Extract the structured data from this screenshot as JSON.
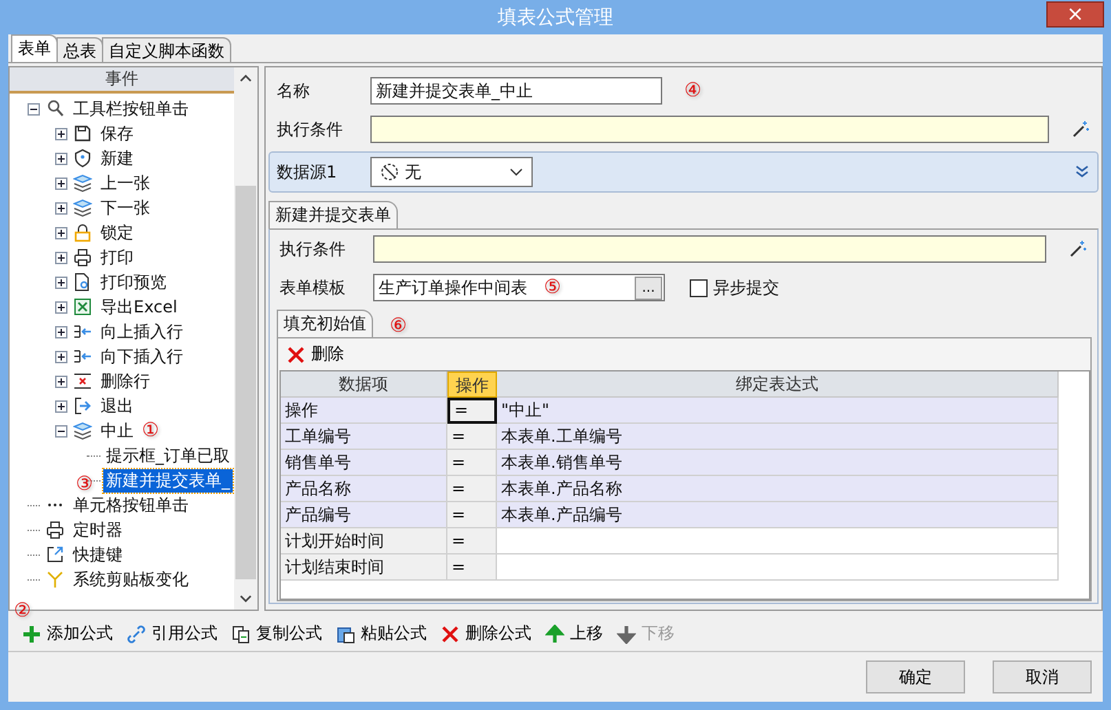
{
  "window": {
    "title": "填表公式管理",
    "close": "×"
  },
  "tabs": [
    {
      "label": "表单",
      "selected": true
    },
    {
      "label": "总表",
      "selected": false
    },
    {
      "label": "自定义脚本函数",
      "selected": false
    }
  ],
  "tree": {
    "header": "事件",
    "items": [
      {
        "label": "工具栏按钮单击",
        "expanded": true,
        "selected": false,
        "children": [
          {
            "label": "保存",
            "expanded": false,
            "selected": false
          },
          {
            "label": "新建",
            "expanded": false,
            "selected": false
          },
          {
            "label": "上一张",
            "expanded": false,
            "selected": false
          },
          {
            "label": "下一张",
            "expanded": false,
            "selected": false
          },
          {
            "label": "锁定",
            "expanded": false,
            "selected": false
          },
          {
            "label": "打印",
            "expanded": false,
            "selected": false
          },
          {
            "label": "打印预览",
            "expanded": false,
            "selected": false
          },
          {
            "label": "导出Excel",
            "expanded": false,
            "selected": false
          },
          {
            "label": "向上插入行",
            "expanded": false,
            "selected": false
          },
          {
            "label": "向下插入行",
            "expanded": false,
            "selected": false
          },
          {
            "label": "删除行",
            "expanded": false,
            "selected": false
          },
          {
            "label": "退出",
            "expanded": false,
            "selected": false
          },
          {
            "label": "中止",
            "expanded": true,
            "selected": false,
            "marker": "①",
            "children": [
              {
                "label": "提示框_订单已取",
                "selected": false
              },
              {
                "label": "新建并提交表单_",
                "selected": true,
                "marker": "③"
              }
            ]
          }
        ]
      },
      {
        "label": "单元格按钮单击",
        "selected": false
      },
      {
        "label": "定时器",
        "selected": false
      },
      {
        "label": "快捷键",
        "selected": false
      },
      {
        "label": "系统剪贴板变化",
        "selected": false
      }
    ]
  },
  "form": {
    "name_label": "名称",
    "name_value": "新建并提交表单_中止",
    "name_marker": "④",
    "condition_label": "执行条件",
    "datasource_label": "数据源1",
    "datasource_value": "无"
  },
  "action_tab": "新建并提交表单",
  "action": {
    "condition_label": "执行条件",
    "template_label": "表单模板",
    "template_value": "生产订单操作中间表",
    "template_marker": "⑤",
    "browse": "...",
    "async_label": "异步提交",
    "async_checked": false
  },
  "fill_tab": {
    "label": "填充初始值",
    "marker": "⑥",
    "delete": "删除"
  },
  "table": {
    "columns": [
      "数据项",
      "操作",
      "绑定表达式"
    ],
    "rows": [
      {
        "item": "操作",
        "op": "=",
        "expr": "\"中止\"",
        "highlighted": true,
        "selected": true
      },
      {
        "item": "工单编号",
        "op": "=",
        "expr": "本表单.工单编号",
        "highlighted": true,
        "selected": false
      },
      {
        "item": "销售单号",
        "op": "=",
        "expr": "本表单.销售单号",
        "highlighted": true,
        "selected": false
      },
      {
        "item": "产品名称",
        "op": "=",
        "expr": "本表单.产品名称",
        "highlighted": true,
        "selected": false
      },
      {
        "item": "产品编号",
        "op": "=",
        "expr": "本表单.产品编号",
        "highlighted": true,
        "selected": false
      },
      {
        "item": "计划开始时间",
        "op": "=",
        "highlighted": false,
        "selected": false
      },
      {
        "item": "计划结束时间",
        "op": "=",
        "highlighted": false,
        "selected": false
      }
    ]
  },
  "toolbar": {
    "marker": "②",
    "items": [
      {
        "label": "添加公式",
        "disabled": false
      },
      {
        "label": "引用公式",
        "disabled": false
      },
      {
        "label": "复制公式",
        "disabled": false
      },
      {
        "label": "粘贴公式",
        "disabled": false
      },
      {
        "label": "删除公式",
        "disabled": false
      },
      {
        "label": "上移",
        "disabled": false
      },
      {
        "label": "下移",
        "disabled": true
      }
    ]
  },
  "buttons": [
    "确定",
    "取消"
  ]
}
